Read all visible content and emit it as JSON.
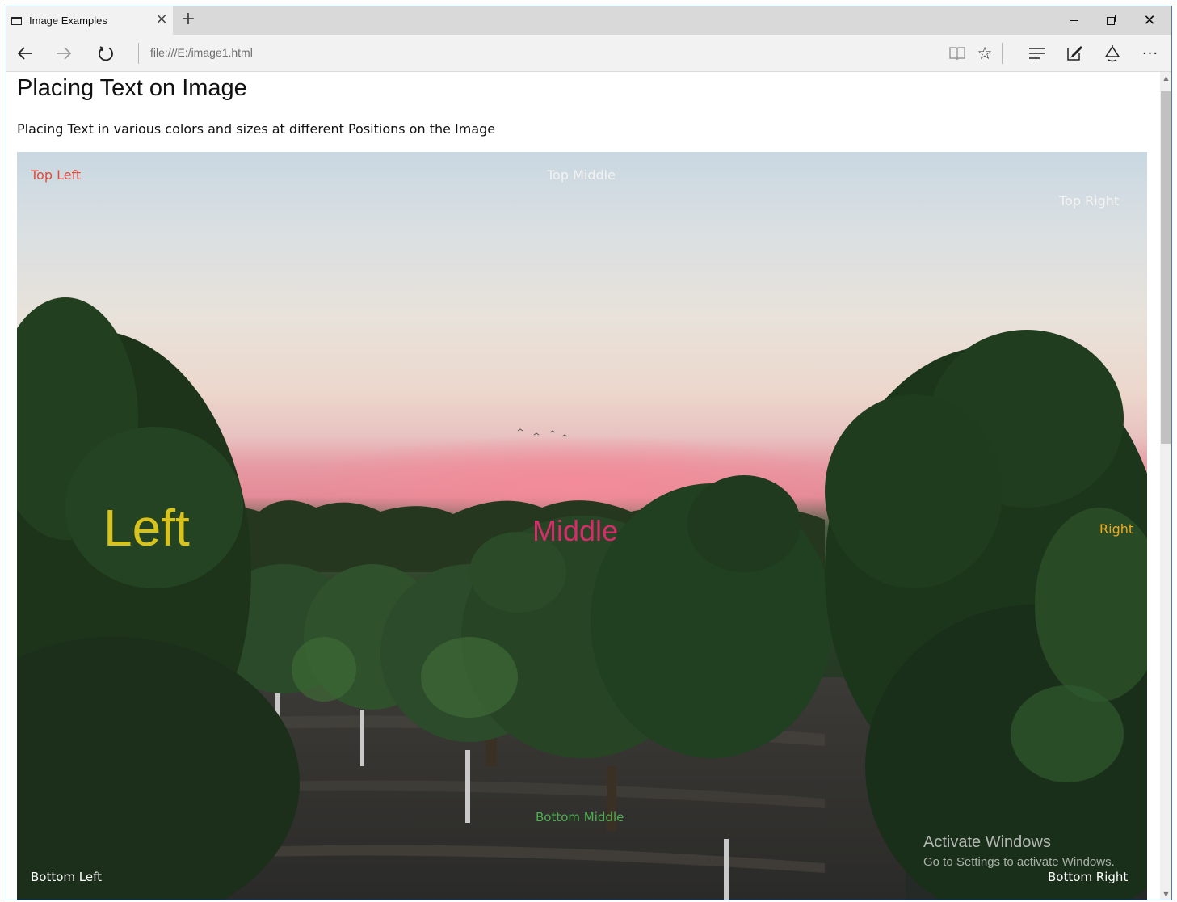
{
  "browser": {
    "tab_title": "Image Examples",
    "tab_icon": "tab-page-icon",
    "address": "file:///E:/image1.html"
  },
  "page": {
    "title": "Placing Text on Image",
    "subtitle": "Placing Text in various colors and sizes at different Positions on the Image"
  },
  "overlays": {
    "top_left": "Top Left",
    "top_middle": "Top Middle",
    "top_right": "Top Right",
    "left": "Left",
    "middle": "Middle",
    "right": "Right",
    "bottom_middle": "Bottom Middle",
    "bottom_left": "Bottom Left",
    "bottom_right": "Bottom Right"
  },
  "watermark": {
    "title": "Activate Windows",
    "subtitle": "Go to Settings to activate Windows."
  },
  "colors": {
    "top_left": "#e24a3b",
    "top_middle": "#f2f2f2",
    "top_right": "#f4f4f4",
    "left": "#d8c21e",
    "middle": "#d62d6a",
    "right": "#f0a820",
    "bottom_middle": "#4caf50",
    "bottom_left": "#ffffff",
    "bottom_right": "#ffffff",
    "window_border": "#4a7ab8"
  }
}
